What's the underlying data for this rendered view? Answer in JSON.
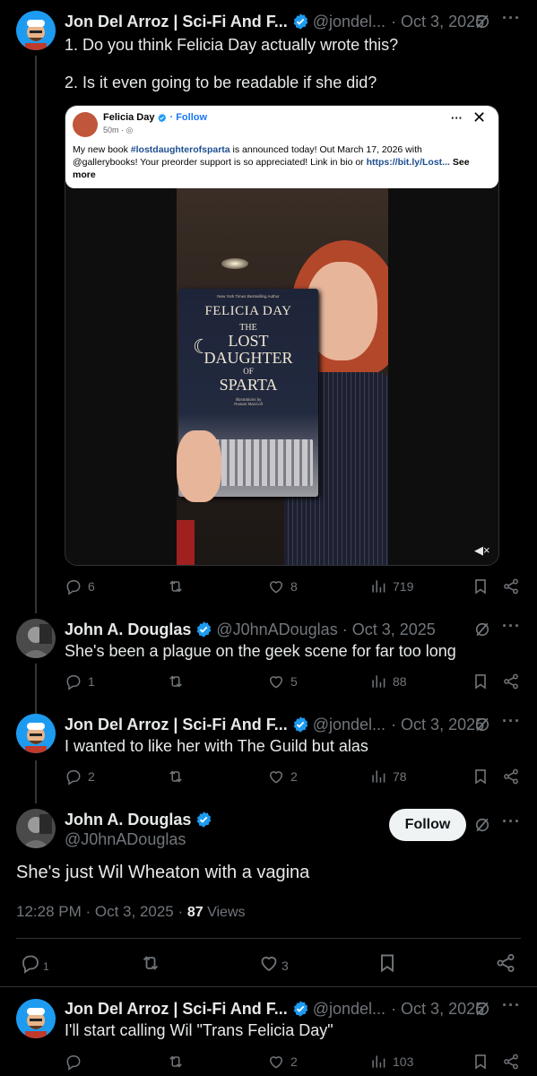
{
  "colors": {
    "accent": "#1d9bf0",
    "bg": "#000000",
    "text": "#e7e9ea",
    "muted": "#71767b",
    "verified": "#1d9bf0"
  },
  "tweet1": {
    "name": "Jon Del Arroz | Sci-Fi And F...",
    "handle": "@jondel...",
    "date": "· Oct 3, 2025",
    "line1": "1. Do you think Felicia Day actually wrote this?",
    "line2": "2. Is it even going to be readable if she did?",
    "replies": "6",
    "likes": "8",
    "views": "719",
    "embed": {
      "author": "Felicia Day",
      "follow": "· Follow",
      "time": "50m ·",
      "text_a": "My new book ",
      "hashtag": "#lostdaughterofsparta",
      "text_b": " is announced today! Out March 17, 2026 with @gallerybooks! Your preorder support is so appreciated! Link in bio or ",
      "link": "https://bit.ly/Lost...",
      "see_more": " See more",
      "book_top": "New York Times Bestselling Author",
      "book_author": "FELICIA DAY",
      "book_the": "THE",
      "book_lost": "LOST",
      "book_daughter": "DAUGHTER",
      "book_of": "OF",
      "book_sparta": "SPARTA",
      "book_illus": "Illustrations by",
      "book_illustrator": "Rowan MacColl"
    }
  },
  "tweet2": {
    "name": "John A. Douglas",
    "handle": "@J0hnADouglas · Oct 3, 2025",
    "text": "She's been a plague on the geek scene for far too long",
    "replies": "1",
    "likes": "5",
    "views": "88"
  },
  "tweet3": {
    "name": "Jon Del Arroz | Sci-Fi And F...",
    "handle": "@jondel...",
    "date": "· Oct 3, 2025",
    "text": "I wanted to like her with The Guild but alas",
    "replies": "2",
    "likes": "2",
    "views": "78"
  },
  "main": {
    "name": "John A. Douglas",
    "handle": "@J0hnADouglas",
    "follow": "Follow",
    "text": "She's just Wil Wheaton with a vagina",
    "timestamp": "12:28 PM · Oct 3, 2025 · ",
    "views_count": "87",
    "views_label": " Views",
    "replies": "1",
    "likes": "3"
  },
  "tweet5": {
    "name": "Jon Del Arroz | Sci-Fi And F...",
    "handle": "@jondel...",
    "date": "· Oct 3, 2025",
    "text": "I'll start calling Wil \"Trans Felicia Day\"",
    "likes": "2",
    "views": "103"
  }
}
